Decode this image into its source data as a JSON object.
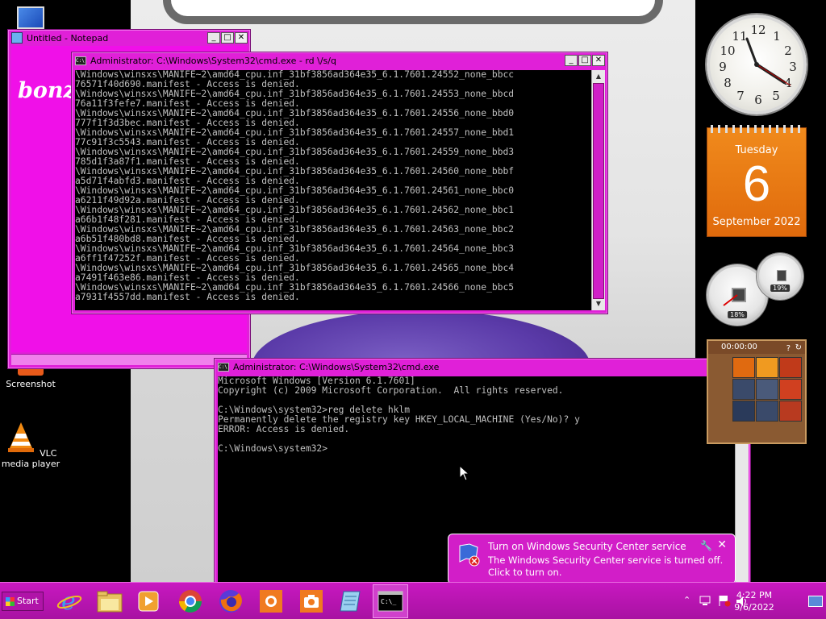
{
  "desktop": {
    "icons": [
      {
        "label": "Screenshot"
      },
      {
        "label": "VLC media player"
      }
    ]
  },
  "notepad": {
    "title": "Untitled - Notepad",
    "content": "bonzi"
  },
  "cmd_top": {
    "title": "Administrator: C:\\Windows\\System32\\cmd.exe - rd \\/s/q",
    "lines": [
      "\\Windows\\winsxs\\MANIFE~2\\amd64_cpu.inf_31bf3856ad364e35_6.1.7601.24552_none_bbcc",
      "76571f40d690.manifest - Access is denied.",
      "\\Windows\\winsxs\\MANIFE~2\\amd64_cpu.inf_31bf3856ad364e35_6.1.7601.24553_none_bbcd",
      "76a11f3fefe7.manifest - Access is denied.",
      "\\Windows\\winsxs\\MANIFE~2\\amd64_cpu.inf_31bf3856ad364e35_6.1.7601.24556_none_bbd0",
      "777f1f3d3bec.manifest - Access is denied.",
      "\\Windows\\winsxs\\MANIFE~2\\amd64_cpu.inf_31bf3856ad364e35_6.1.7601.24557_none_bbd1",
      "77c91f3c5543.manifest - Access is denied.",
      "\\Windows\\winsxs\\MANIFE~2\\amd64_cpu.inf_31bf3856ad364e35_6.1.7601.24559_none_bbd3",
      "785d1f3a87f1.manifest - Access is denied.",
      "\\Windows\\winsxs\\MANIFE~2\\amd64_cpu.inf_31bf3856ad364e35_6.1.7601.24560_none_bbbf",
      "a5d71f4abfd3.manifest - Access is denied.",
      "\\Windows\\winsxs\\MANIFE~2\\amd64_cpu.inf_31bf3856ad364e35_6.1.7601.24561_none_bbc0",
      "a6211f49d92a.manifest - Access is denied.",
      "\\Windows\\winsxs\\MANIFE~2\\amd64_cpu.inf_31bf3856ad364e35_6.1.7601.24562_none_bbc1",
      "a66b1f48f281.manifest - Access is denied.",
      "\\Windows\\winsxs\\MANIFE~2\\amd64_cpu.inf_31bf3856ad364e35_6.1.7601.24563_none_bbc2",
      "a6b51f480bd8.manifest - Access is denied.",
      "\\Windows\\winsxs\\MANIFE~2\\amd64_cpu.inf_31bf3856ad364e35_6.1.7601.24564_none_bbc3",
      "a6ff1f47252f.manifest - Access is denied.",
      "\\Windows\\winsxs\\MANIFE~2\\amd64_cpu.inf_31bf3856ad364e35_6.1.7601.24565_none_bbc4",
      "a7491f463e86.manifest - Access is denied.",
      "\\Windows\\winsxs\\MANIFE~2\\amd64_cpu.inf_31bf3856ad364e35_6.1.7601.24566_none_bbc5",
      "a7931f4557dd.manifest - Access is denied."
    ]
  },
  "cmd_bottom": {
    "title": "Administrator: C:\\Windows\\System32\\cmd.exe",
    "lines": [
      "Microsoft Windows [Version 6.1.7601]",
      "Copyright (c) 2009 Microsoft Corporation.  All rights reserved.",
      "",
      "C:\\Windows\\system32>reg delete hklm",
      "Permanently delete the registry key HKEY_LOCAL_MACHINE (Yes/No)? y",
      "ERROR: Access is denied.",
      "",
      "C:\\Windows\\system32>"
    ]
  },
  "gadgets": {
    "calendar": {
      "weekday": "Tuesday",
      "day": "6",
      "month_year": "September 2022"
    },
    "cpu_meter": {
      "cpu": "18%",
      "memory": "19%"
    },
    "puzzle": {
      "timer": "00:00:00"
    }
  },
  "notification": {
    "title": "Turn on Windows Security Center service",
    "body": "The Windows Security Center service is turned off. Click to turn on."
  },
  "taskbar": {
    "start_label": "Start",
    "time": "4:22 PM",
    "date": "9/6/2022",
    "pinned": [
      "internet-explorer",
      "file-explorer",
      "media-player",
      "chrome",
      "firefox",
      "screenshot-tool",
      "camera-app",
      "notepad",
      "command-prompt"
    ]
  },
  "colors": {
    "accent": "#e020d8",
    "taskbar": "#b814b0",
    "console_bg": "#000000",
    "console_text": "#c0c0c0"
  }
}
